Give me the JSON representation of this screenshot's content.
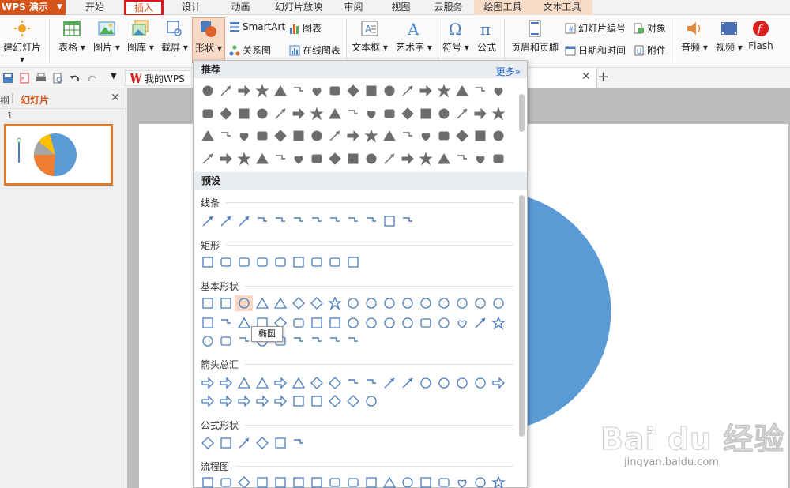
{
  "app": {
    "name": "WPS 演示"
  },
  "tabs": [
    {
      "label": "开始"
    },
    {
      "label": "插入"
    },
    {
      "label": "设计"
    },
    {
      "label": "动画"
    },
    {
      "label": "幻灯片放映"
    },
    {
      "label": "审阅"
    },
    {
      "label": "视图"
    },
    {
      "label": "云服务"
    },
    {
      "label": "绘图工具"
    },
    {
      "label": "文本工具"
    }
  ],
  "ribbon": {
    "new_slide": "建幻灯片 ▾",
    "table": "表格 ▾",
    "picture": "图片 ▾",
    "gallery": "图库 ▾",
    "screenshot": "截屏 ▾",
    "shape": "形状 ▾",
    "smartart": "SmartArt",
    "chart": "图表",
    "relation": "关系图",
    "online_chart": "在线图表",
    "textbox": "文本框 ▾",
    "wordart": "艺术字 ▾",
    "symbol": "符号 ▾",
    "formula": "公式",
    "header_footer": "页眉和页脚",
    "slide_number": "幻灯片编号",
    "object": "对象",
    "date_time": "日期和时间",
    "attachment": "附件",
    "audio": "音频 ▾",
    "video": "视频 ▾",
    "flash": "Flash"
  },
  "qat": {
    "my_wps": "我的WPS"
  },
  "panel": {
    "outline_tab": "纲",
    "slides_tab": "幻灯片",
    "slide_num": "1"
  },
  "dropdown": {
    "recommended": "推荐",
    "more": "更多»",
    "preset": "预设",
    "cat_lines": "线条",
    "cat_rect": "矩形",
    "cat_basic": "基本形状",
    "cat_arrows": "箭头总汇",
    "cat_formula": "公式形状",
    "cat_flow": "流程图",
    "tooltip": "椭圆"
  },
  "watermark": {
    "brand": "Bai du 经验",
    "url": "jingyan.baidu.com"
  },
  "colors": {
    "accent": "#d4541a",
    "highlight": "#e0151a",
    "pie_blue": "#5b9bd5",
    "pie_orange": "#ed7d31",
    "icon_gray": "#6d6d6d",
    "icon_blue": "#4a7dbf"
  }
}
